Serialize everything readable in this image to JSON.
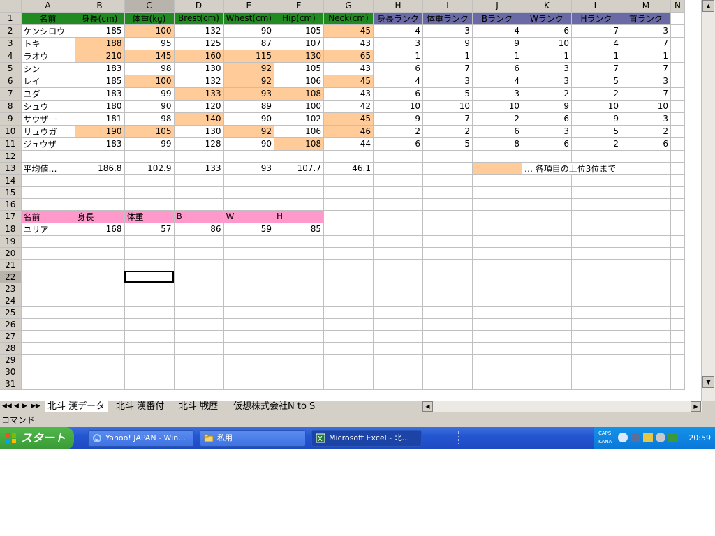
{
  "col_letters": [
    "A",
    "B",
    "C",
    "D",
    "E",
    "F",
    "G",
    "H",
    "I",
    "J",
    "K",
    "L",
    "M",
    "N"
  ],
  "row_numbers": [
    "1",
    "2",
    "3",
    "4",
    "5",
    "6",
    "7",
    "8",
    "9",
    "10",
    "11",
    "12",
    "13",
    "14",
    "15",
    "16",
    "17",
    "18",
    "19",
    "20",
    "21",
    "22",
    "23",
    "24",
    "25",
    "26",
    "27",
    "28",
    "29",
    "30",
    "31"
  ],
  "table1": {
    "headers": [
      "名前",
      "身長(cm)",
      "体重(kg)",
      "Brest(cm)",
      "Whest(cm)",
      "Hip(cm)",
      "Neck(cm)",
      "身長ランク",
      "体重ランク",
      "Bランク",
      "Wランク",
      "Hランク",
      "首ランク"
    ],
    "rows": [
      {
        "name": "ケンシロウ",
        "vals": [
          "185",
          "100",
          "132",
          "90",
          "105",
          "45"
        ],
        "ranks": [
          "4",
          "3",
          "4",
          "6",
          "7",
          "3"
        ]
      },
      {
        "name": "トキ",
        "vals": [
          "188",
          "95",
          "125",
          "87",
          "107",
          "43"
        ],
        "ranks": [
          "3",
          "9",
          "9",
          "10",
          "4",
          "7"
        ]
      },
      {
        "name": "ラオウ",
        "vals": [
          "210",
          "145",
          "160",
          "115",
          "130",
          "65"
        ],
        "ranks": [
          "1",
          "1",
          "1",
          "1",
          "1",
          "1"
        ]
      },
      {
        "name": "シン",
        "vals": [
          "183",
          "98",
          "130",
          "92",
          "105",
          "43"
        ],
        "ranks": [
          "6",
          "7",
          "6",
          "3",
          "7",
          "7"
        ]
      },
      {
        "name": "レイ",
        "vals": [
          "185",
          "100",
          "132",
          "92",
          "106",
          "45"
        ],
        "ranks": [
          "4",
          "3",
          "4",
          "3",
          "5",
          "3"
        ]
      },
      {
        "name": "ユダ",
        "vals": [
          "183",
          "99",
          "133",
          "93",
          "108",
          "43"
        ],
        "ranks": [
          "6",
          "5",
          "3",
          "2",
          "2",
          "7"
        ]
      },
      {
        "name": "シュウ",
        "vals": [
          "180",
          "90",
          "120",
          "89",
          "100",
          "42"
        ],
        "ranks": [
          "10",
          "10",
          "10",
          "9",
          "10",
          "10"
        ]
      },
      {
        "name": "サウザー",
        "vals": [
          "181",
          "98",
          "140",
          "90",
          "102",
          "45"
        ],
        "ranks": [
          "9",
          "7",
          "2",
          "6",
          "9",
          "3"
        ]
      },
      {
        "name": "リュウガ",
        "vals": [
          "190",
          "105",
          "130",
          "92",
          "106",
          "46"
        ],
        "ranks": [
          "2",
          "2",
          "6",
          "3",
          "5",
          "2"
        ]
      },
      {
        "name": "ジュウザ",
        "vals": [
          "183",
          "99",
          "128",
          "90",
          "108",
          "44"
        ],
        "ranks": [
          "6",
          "5",
          "8",
          "6",
          "2",
          "6"
        ]
      }
    ]
  },
  "average": {
    "label": "平均値…",
    "vals": [
      "186.8",
      "102.9",
      "133",
      "93",
      "107.7",
      "46.1"
    ]
  },
  "legend": {
    "color": "#ffcc99",
    "text": "… 各項目の上位3位まで"
  },
  "table2": {
    "headers": [
      "名前",
      "身長",
      "体重",
      "B",
      "W",
      "H"
    ],
    "row": {
      "name": "ユリア",
      "vals": [
        "168",
        "57",
        "86",
        "59",
        "85"
      ]
    }
  },
  "colors": {
    "highlight": "#ffcc99",
    "green_header": "#218a21",
    "purple_header": "#6a6aa6",
    "pink_header": "#ff99cc"
  },
  "sheet_tabs": [
    "北斗 漢データ",
    "北斗 漢番付",
    "北斗 戦歴",
    "仮想株式会社N to S"
  ],
  "status_text": "コマンド",
  "taskbar": {
    "start_label": "スタート",
    "buttons": [
      "Yahoo! JAPAN - Win...",
      "私用",
      "Microsoft Excel - 北..."
    ],
    "caps": "CAPS",
    "kana": "KANA",
    "clock": "20:59"
  }
}
